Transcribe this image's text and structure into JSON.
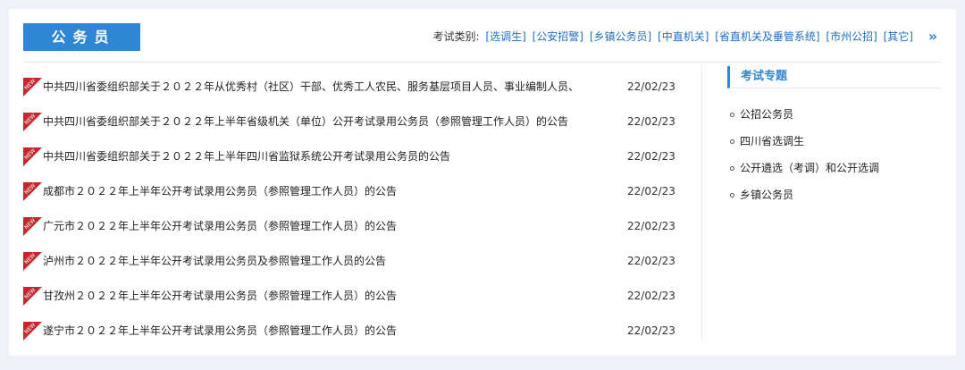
{
  "section": {
    "title": "公务员"
  },
  "categories": {
    "label": "考试类别:",
    "links": [
      "[选调生]",
      "[公安招警]",
      "[乡镇公务员]",
      "[中直机关]",
      "[省直机关及垂管系统]",
      "[市州公招]",
      "[其它]"
    ],
    "more_icon": "»"
  },
  "news": [
    {
      "title": "中共四川省委组织部关于２０２２年从优秀村（社区）干部、优秀工人农民、服务基层项目人员、事业编制人员、",
      "date": "22/02/23",
      "new_badge": "NEW"
    },
    {
      "title": "中共四川省委组织部关于２０２２年上半年省级机关（单位）公开考试录用公务员（参照管理工作人员）的公告",
      "date": "22/02/23",
      "new_badge": "NEW"
    },
    {
      "title": "中共四川省委组织部关于２０２２年上半年四川省监狱系统公开考试录用公务员的公告",
      "date": "22/02/23",
      "new_badge": "NEW"
    },
    {
      "title": "成都市２０２２年上半年公开考试录用公务员（参照管理工作人员）的公告",
      "date": "22/02/23",
      "new_badge": "NEW"
    },
    {
      "title": "广元市２０２２年上半年公开考试录用公务员（参照管理工作人员）的公告",
      "date": "22/02/23",
      "new_badge": "NEW"
    },
    {
      "title": "泸州市２０２２年上半年公开考试录用公务员及参照管理工作人员的公告",
      "date": "22/02/23",
      "new_badge": "NEW"
    },
    {
      "title": "甘孜州２０２２年上半年公开考试录用公务员（参照管理工作人员）的公告",
      "date": "22/02/23",
      "new_badge": "NEW"
    },
    {
      "title": "遂宁市２０２２年上半年公开考试录用公务员（参照管理工作人员）的公告",
      "date": "22/02/23",
      "new_badge": "NEW"
    }
  ],
  "topics": {
    "title": "考试专题",
    "items": [
      "公招公务员",
      "四川省选调生",
      "公开遴选（考调）和公开选调",
      "乡镇公务员"
    ]
  },
  "colors": {
    "accent": "#2f86d3",
    "new_badge": "#c8262e",
    "link": "#1f6fc0"
  }
}
